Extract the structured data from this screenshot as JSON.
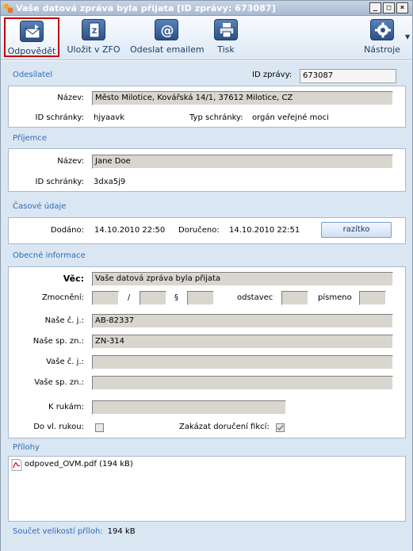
{
  "window": {
    "title": "Vaše datová zpráva byla přijata [ID zprávy: 673087]"
  },
  "toolbar": {
    "reply": "Odpovědět",
    "save_zfo": "Uložit v ZFO",
    "send_email": "Odeslat emailem",
    "print": "Tisk",
    "tools": "Nástroje"
  },
  "sender": {
    "heading": "Odesílatel",
    "id_label": "ID zprávy:",
    "id_value": "673087",
    "name_label": "Název:",
    "name_value": "Město Milotice, Kovářská 14/1, 37612 Milotice, CZ",
    "box_id_label": "ID schránky:",
    "box_id_value": "hjyaavk",
    "box_type_label": "Typ schránky:",
    "box_type_value": "orgán veřejné moci"
  },
  "recipient": {
    "heading": "Příjemce",
    "name_label": "Název:",
    "name_value": "Jane Doe",
    "box_id_label": "ID schránky:",
    "box_id_value": "3dxa5j9"
  },
  "timing": {
    "heading": "Časové údaje",
    "delivered_label": "Dodáno:",
    "delivered_value": "14.10.2010 22:50",
    "received_label": "Doručeno:",
    "received_value": "14.10.2010 22:51",
    "stamp_button": "razítko"
  },
  "general": {
    "heading": "Obecné informace",
    "subject_label": "Věc:",
    "subject_value": "Vaše datová zpráva byla přijata",
    "authority_label": "Zmocnění:",
    "slash": "/",
    "section": "§",
    "paragraph_label": "odstavec",
    "letter_label": "písmeno",
    "our_ref_label": "Naše č. j.:",
    "our_ref_value": "AB-82337",
    "our_file_label": "Naše sp. zn.:",
    "our_file_value": "ZN-314",
    "your_ref_label": "Vaše č. j.:",
    "your_ref_value": "",
    "your_file_label": "Vaše sp. zn.:",
    "your_file_value": "",
    "attention_label": "K rukám:",
    "attention_value": "",
    "personal_label": "Do vl. rukou:",
    "fiction_label": "Zakázat doručení fikcí:"
  },
  "attachments": {
    "heading": "Přílohy",
    "items": [
      {
        "name": "odpoved_OVM.pdf (194 kB)",
        "icon": "pdf-icon"
      }
    ],
    "total_label": "Součet velikostí příloh:",
    "total_value": "194 kB"
  }
}
